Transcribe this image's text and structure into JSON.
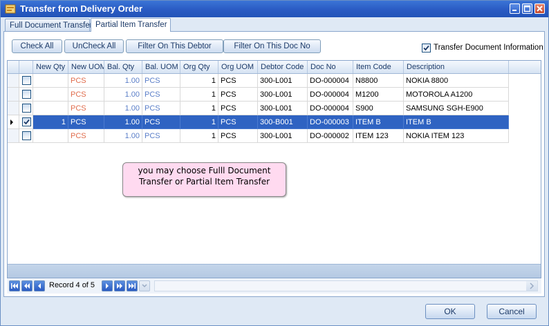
{
  "window": {
    "title": "Transfer from Delivery Order"
  },
  "tabs": [
    {
      "label": "Full Document Transfer"
    },
    {
      "label": "Partial Item Transfer"
    }
  ],
  "toolbar": {
    "check_all": "Check All",
    "uncheck_all": "UnCheck All",
    "filter_debtor": "Filter On This Debtor",
    "filter_doc": "Filter On This Doc No",
    "transfer_info_label": "Transfer Document Information",
    "transfer_info_checked": true
  },
  "grid": {
    "columns": [
      "New Qty",
      "New UOM",
      "Bal. Qty",
      "Bal. UOM",
      "Org Qty",
      "Org UOM",
      "Debtor Code",
      "Doc No",
      "Item Code",
      "Description"
    ],
    "rows": [
      {
        "checked": false,
        "new_qty": "",
        "new_uom": "PCS",
        "bal_qty": "1.00",
        "bal_uom": "PCS",
        "org_qty": "1",
        "org_uom": "PCS",
        "debtor": "300-L001",
        "doc_no": "DO-000004",
        "item_code": "N8800",
        "description": "NOKIA 8800"
      },
      {
        "checked": false,
        "new_qty": "",
        "new_uom": "PCS",
        "bal_qty": "1.00",
        "bal_uom": "PCS",
        "org_qty": "1",
        "org_uom": "PCS",
        "debtor": "300-L001",
        "doc_no": "DO-000004",
        "item_code": "M1200",
        "description": "MOTOROLA A1200"
      },
      {
        "checked": false,
        "new_qty": "",
        "new_uom": "PCS",
        "bal_qty": "1.00",
        "bal_uom": "PCS",
        "org_qty": "1",
        "org_uom": "PCS",
        "debtor": "300-L001",
        "doc_no": "DO-000004",
        "item_code": "S900",
        "description": "SAMSUNG SGH-E900"
      },
      {
        "checked": true,
        "new_qty": "1",
        "new_uom": "PCS",
        "bal_qty": "1.00",
        "bal_uom": "PCS",
        "org_qty": "1",
        "org_uom": "PCS",
        "debtor": "300-B001",
        "doc_no": "DO-000003",
        "item_code": "ITEM B",
        "description": "ITEM B"
      },
      {
        "checked": false,
        "new_qty": "",
        "new_uom": "PCS",
        "bal_qty": "1.00",
        "bal_uom": "PCS",
        "org_qty": "1",
        "org_uom": "PCS",
        "debtor": "300-L001",
        "doc_no": "DO-000002",
        "item_code": "ITEM 123",
        "description": "NOKIA ITEM 123"
      }
    ]
  },
  "note": {
    "text": "you may choose Fulll Document Transfer or Partial Item Transfer"
  },
  "navigator": {
    "record_text": "Record 4 of 5"
  },
  "buttons": {
    "ok": "OK",
    "cancel": "Cancel"
  },
  "colors": {
    "title_bar": "#2a5bc3",
    "selection": "#2f63c2",
    "uom_text": "#e06c4c",
    "balance_text": "#5a7ec8",
    "note_bg": "#ffdaf0"
  }
}
